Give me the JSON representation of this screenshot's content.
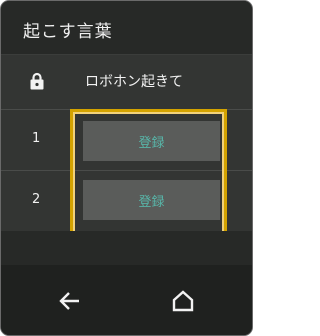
{
  "header": {
    "title": "起こす言葉"
  },
  "list": {
    "locked": {
      "icon": "lock-icon",
      "label": "ロボホン起きて"
    },
    "rows": [
      {
        "number": "1",
        "button_label": "登録"
      },
      {
        "number": "2",
        "button_label": "登録"
      }
    ]
  },
  "navbar": {
    "back_icon": "back-arrow-icon",
    "home_icon": "home-icon"
  },
  "colors": {
    "background": "#272927",
    "row": "#333533",
    "button": "#5a5c5a",
    "button_text": "#58b5a8",
    "highlight": "#d4a300"
  }
}
